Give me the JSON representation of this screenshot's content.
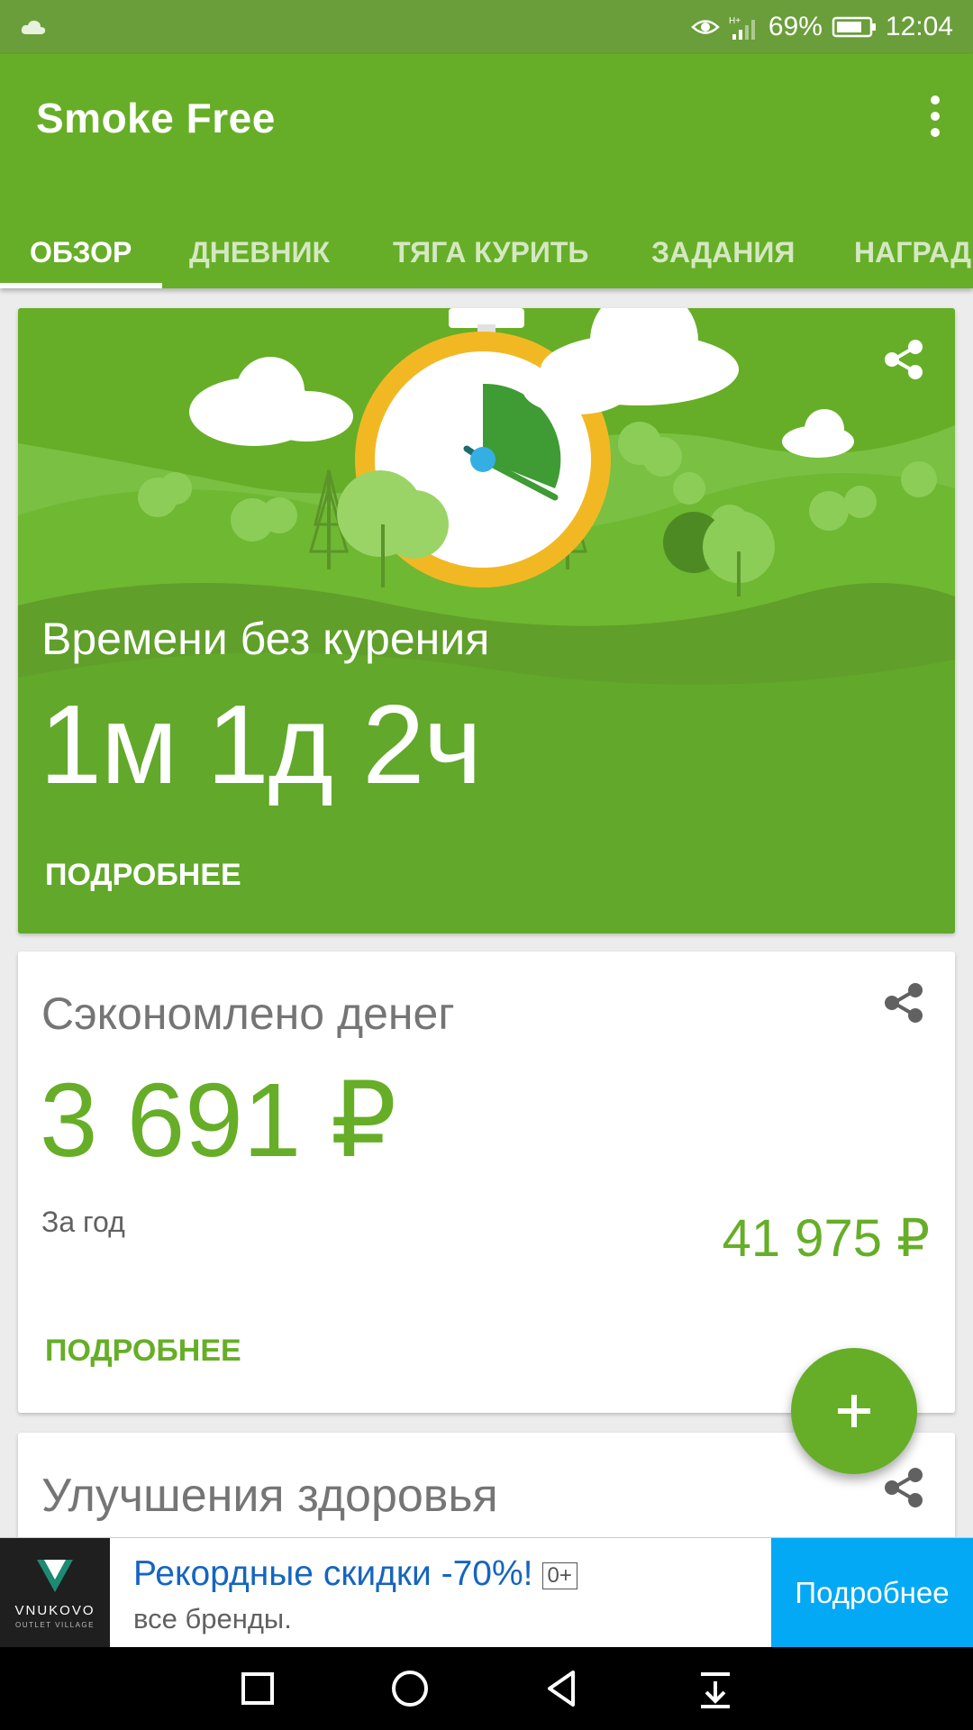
{
  "status_bar": {
    "battery": "69%",
    "time": "12:04"
  },
  "app_bar": {
    "title": "Smoke Free"
  },
  "tabs": [
    {
      "label": "ОБЗОР",
      "active": true
    },
    {
      "label": "ДНЕВНИК"
    },
    {
      "label": "ТЯГА КУРИТЬ"
    },
    {
      "label": "ЗАДАНИЯ"
    },
    {
      "label": "НАГРАДЫ"
    }
  ],
  "smoke_free_card": {
    "label": "Времени без курения",
    "value": "1м 1д 2ч",
    "more": "ПОДРОБНЕЕ"
  },
  "money_card": {
    "label": "Сэкономлено денег",
    "value": "3 691 ₽",
    "year_label": "За год",
    "year_value": "41 975 ₽",
    "more": "ПОДРОБНЕЕ"
  },
  "health_card": {
    "label": "Улучшения здоровья"
  },
  "ad_banner": {
    "logo_brand": "VNUKOVO",
    "logo_sub": "OUTLET VILLAGE",
    "headline": "Рекордные скидки -70%!",
    "age_rating": "0+",
    "subline": "все бренды.",
    "cta": "Подробнее"
  },
  "colors": {
    "primary": "#66ae27",
    "status_bar": "#6a9e3a",
    "ad_cta": "#03a9f4",
    "ad_headline": "#1565c0"
  }
}
